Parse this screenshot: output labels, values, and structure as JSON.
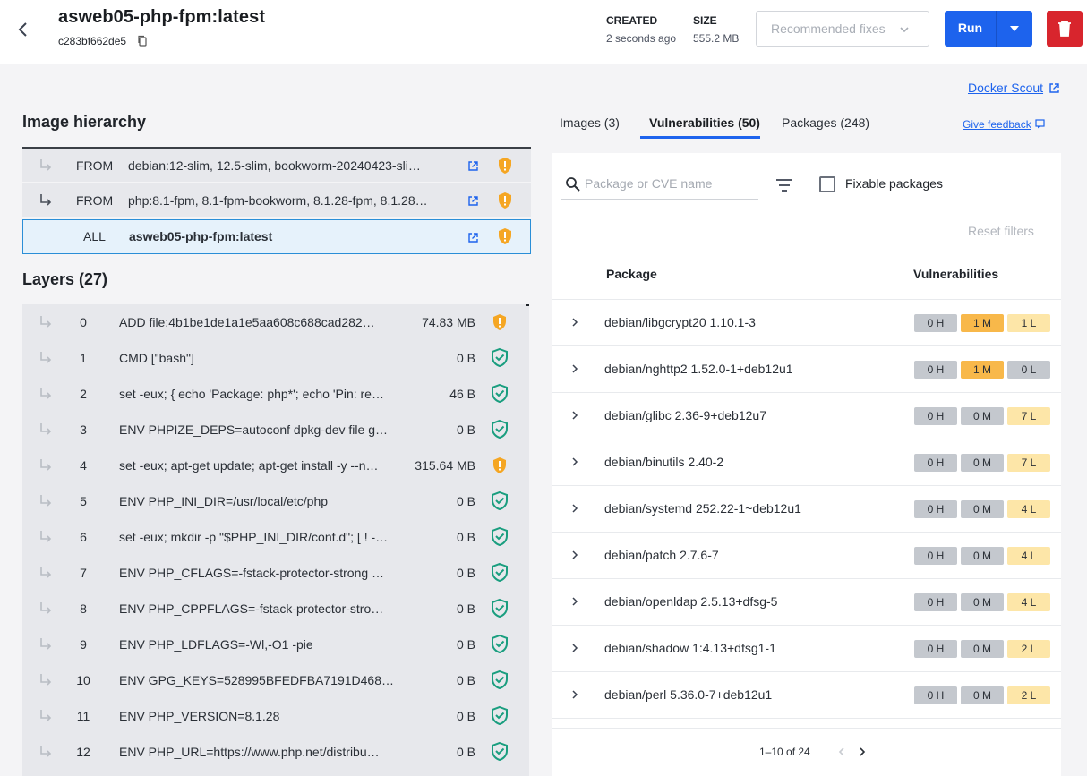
{
  "header": {
    "title": "asweb05-php-fpm:latest",
    "hash": "c283bf662de5",
    "created_label": "CREATED",
    "created_value": "2 seconds ago",
    "size_label": "SIZE",
    "size_value": "555.2 MB",
    "recommended_label": "Recommended fixes",
    "run_label": "Run"
  },
  "docker_scout_link": "Docker Scout",
  "hierarchy": {
    "heading": "Image hierarchy",
    "rows": [
      {
        "keyword": "FROM",
        "name": "debian:12-slim, 12.5-slim, bookworm-20240423-sli…",
        "status": "warning"
      },
      {
        "keyword": "FROM",
        "name": "php:8.1-fpm, 8.1-fpm-bookworm, 8.1.28-fpm, 8.1.28…",
        "status": "warning"
      },
      {
        "keyword": "ALL",
        "name": "asweb05-php-fpm:latest",
        "status": "warning"
      }
    ]
  },
  "layers": {
    "heading": "Layers (27)",
    "rows": [
      {
        "index": "0",
        "command": "ADD file:4b1be1de1a1e5aa608c688cad282…",
        "size": "74.83 MB",
        "status": "warning"
      },
      {
        "index": "1",
        "command": "CMD [\"bash\"]",
        "size": "0 B",
        "status": "ok"
      },
      {
        "index": "2",
        "command": "set -eux; { echo 'Package: php*'; echo 'Pin: re…",
        "size": "46 B",
        "status": "ok"
      },
      {
        "index": "3",
        "command": "ENV PHPIZE_DEPS=autoconf dpkg-dev file g…",
        "size": "0 B",
        "status": "ok"
      },
      {
        "index": "4",
        "command": "set -eux; apt-get update; apt-get install -y --n…",
        "size": "315.64 MB",
        "status": "warning"
      },
      {
        "index": "5",
        "command": "ENV PHP_INI_DIR=/usr/local/etc/php",
        "size": "0 B",
        "status": "ok"
      },
      {
        "index": "6",
        "command": "set -eux; mkdir -p \"$PHP_INI_DIR/conf.d\"; [ ! -…",
        "size": "0 B",
        "status": "ok"
      },
      {
        "index": "7",
        "command": "ENV PHP_CFLAGS=-fstack-protector-strong …",
        "size": "0 B",
        "status": "ok"
      },
      {
        "index": "8",
        "command": "ENV PHP_CPPFLAGS=-fstack-protector-stro…",
        "size": "0 B",
        "status": "ok"
      },
      {
        "index": "9",
        "command": "ENV PHP_LDFLAGS=-Wl,-O1 -pie",
        "size": "0 B",
        "status": "ok"
      },
      {
        "index": "10",
        "command": "ENV GPG_KEYS=528995BFEDFBA7191D468…",
        "size": "0 B",
        "status": "ok"
      },
      {
        "index": "11",
        "command": "ENV PHP_VERSION=8.1.28",
        "size": "0 B",
        "status": "ok"
      },
      {
        "index": "12",
        "command": "ENV PHP_URL=https://www.php.net/distribu…",
        "size": "0 B",
        "status": "ok"
      }
    ]
  },
  "tabs": [
    {
      "label": "Images (3)",
      "active": false
    },
    {
      "label": "Vulnerabilities (50)",
      "active": true
    },
    {
      "label": "Packages (248)",
      "active": false
    }
  ],
  "feedback_link": "Give feedback",
  "vuln_panel": {
    "search_placeholder": "Package or CVE name",
    "fixable_label": "Fixable packages",
    "reset_label": "Reset filters",
    "col_package": "Package",
    "col_vulns": "Vulnerabilities",
    "rows": [
      {
        "package": "debian/libgcrypt20 1.10.1-3",
        "h": "0 H",
        "m": "1 M",
        "l": "1 L",
        "m_on": true,
        "l_on": true
      },
      {
        "package": "debian/nghttp2 1.52.0-1+deb12u1",
        "h": "0 H",
        "m": "1 M",
        "l": "0 L",
        "m_on": true,
        "l_on": false
      },
      {
        "package": "debian/glibc 2.36-9+deb12u7",
        "h": "0 H",
        "m": "0 M",
        "l": "7 L",
        "m_on": false,
        "l_on": true
      },
      {
        "package": "debian/binutils 2.40-2",
        "h": "0 H",
        "m": "0 M",
        "l": "7 L",
        "m_on": false,
        "l_on": true
      },
      {
        "package": "debian/systemd 252.22-1~deb12u1",
        "h": "0 H",
        "m": "0 M",
        "l": "4 L",
        "m_on": false,
        "l_on": true
      },
      {
        "package": "debian/patch 2.7.6-7",
        "h": "0 H",
        "m": "0 M",
        "l": "4 L",
        "m_on": false,
        "l_on": true
      },
      {
        "package": "debian/openldap 2.5.13+dfsg-5",
        "h": "0 H",
        "m": "0 M",
        "l": "4 L",
        "m_on": false,
        "l_on": true
      },
      {
        "package": "debian/shadow 1:4.13+dfsg1-1",
        "h": "0 H",
        "m": "0 M",
        "l": "2 L",
        "m_on": false,
        "l_on": true
      },
      {
        "package": "debian/perl 5.36.0-7+deb12u1",
        "h": "0 H",
        "m": "0 M",
        "l": "2 L",
        "m_on": false,
        "l_on": true
      }
    ],
    "pagination": "1–10 of 24"
  },
  "colors": {
    "accent": "#1d63ed",
    "danger": "#d8252d",
    "warning": "#f5a623",
    "ok": "#1a9e7f",
    "medium": "#f8b84a",
    "low": "#fde6a8"
  }
}
